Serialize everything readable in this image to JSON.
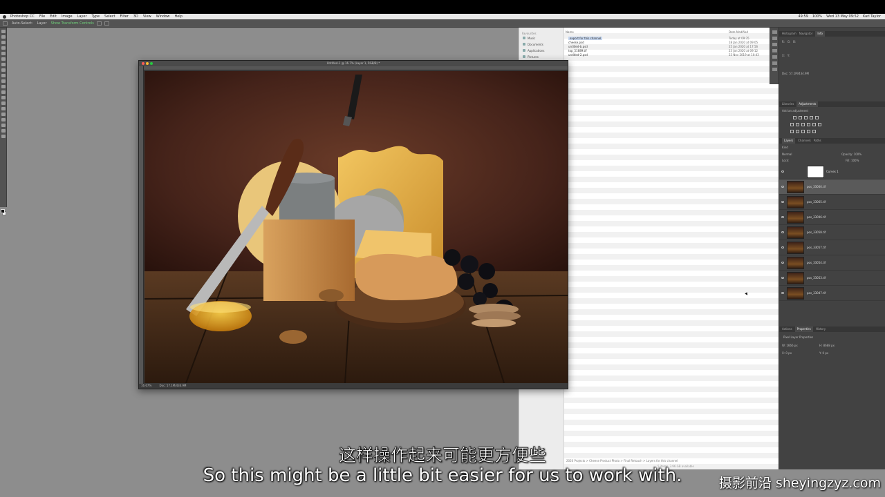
{
  "menubar": {
    "items": [
      "Photoshop CC",
      "File",
      "Edit",
      "Image",
      "Layer",
      "Type",
      "Select",
      "Filter",
      "3D",
      "View",
      "Window",
      "Help"
    ],
    "status": [
      "49:59",
      "100%",
      "Wed 13 May 09:52",
      "Karl Taylor"
    ]
  },
  "options_bar": {
    "auto_select": "Auto-Select:",
    "layer": "Layer",
    "transform": "Show Transform Controls"
  },
  "finder": {
    "sidebar_header": "Favourites",
    "sidebar_items": [
      "Music",
      "Documents",
      "Applications",
      "Pictures"
    ],
    "col_name": "Name",
    "col_date": "Date Modified",
    "rows": [
      {
        "name": "export for this channel",
        "date": "Today at 09:35"
      },
      {
        "name": "cheese.psd",
        "date": "18 Jan 2020 at 09:05"
      },
      {
        "name": "untitled-b.psd",
        "date": "25 Jan 2020 at 17:56"
      },
      {
        "name": "top_51689.tif",
        "date": "23 Jan 2020 at 09:12"
      },
      {
        "name": "untitled-2.psd",
        "date": "23 Nov 2019 at 10:43"
      }
    ],
    "path": "2020 Projects > Cheese Product Photo > Final Retouch > Layers for this channel",
    "status": "5 items, 3.96 GB available"
  },
  "document": {
    "title": "Untitled-1 @ 16.7% (Layer 1, RGB/8) *",
    "zoom": "16.67%",
    "doc_size": "Doc: 57.1M/434.9M"
  },
  "panels": {
    "top_tabs": [
      "Histogram",
      "Navigator",
      "Info"
    ],
    "info_doc": "Doc: 57.1M/434.9M",
    "mid_tabs": [
      "Libraries",
      "Adjustments"
    ],
    "adj_label": "Add an adjustment",
    "layer_tabs": [
      "Layers",
      "Channels",
      "Paths"
    ],
    "kind": "Kind",
    "blend_mode": "Normal",
    "opacity": "Opacity: 100%",
    "lock": "Lock:",
    "fill": "Fill: 100%",
    "layers": [
      {
        "name": "Curves 1",
        "type": "adjustment"
      },
      {
        "name": "pos_33060.tif",
        "selected": true
      },
      {
        "name": "pos_33065.tif"
      },
      {
        "name": "pos_33096.tif"
      },
      {
        "name": "pos_33058.tif"
      },
      {
        "name": "pos_33057.tif"
      },
      {
        "name": "pos_33054.tif"
      },
      {
        "name": "pos_33053.tif"
      },
      {
        "name": "pos_33047.tif"
      }
    ],
    "props_tabs": [
      "Actions",
      "Properties",
      "History"
    ],
    "props_title": "Pixel Layer Properties",
    "w": "W: 1666 px",
    "h": "H: 8688 px",
    "x": "X: 0 px",
    "y": "Y: 0 px"
  },
  "subtitle_cn": "这样操作起来可能更方便些",
  "subtitle_en": "So this might be a little bit easier for us to work with.",
  "watermark": "摄影前沿 sheyingzyz.com",
  "colors": {
    "accent_green": "#6fd07a",
    "panel_bg": "#424242",
    "canvas_bg": "#8d8d8d"
  }
}
